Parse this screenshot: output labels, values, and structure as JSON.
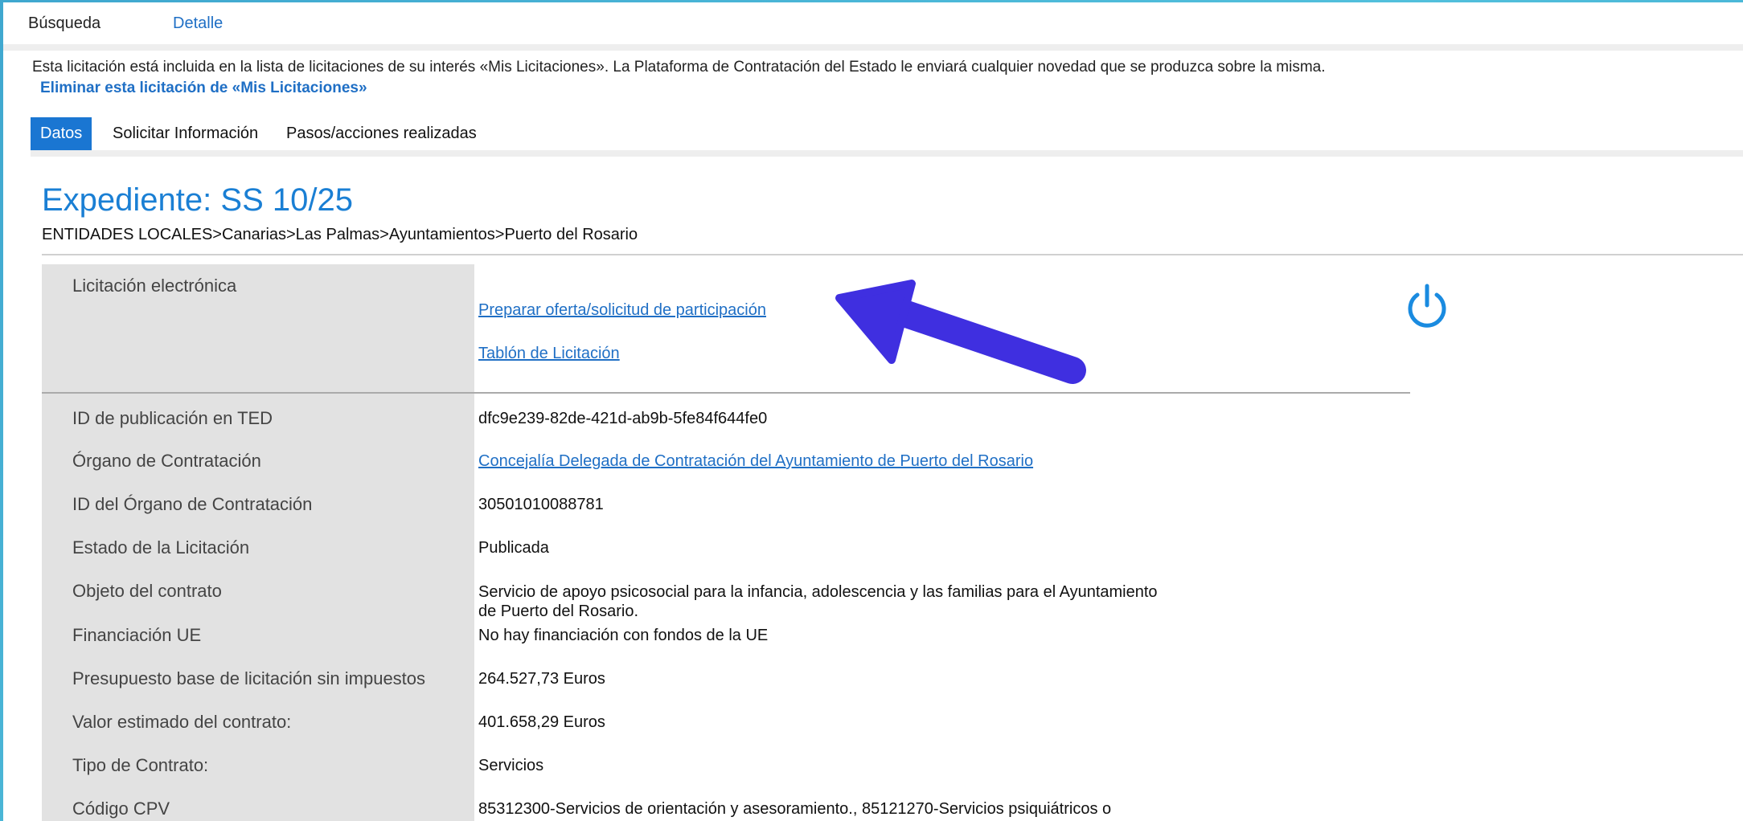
{
  "nav": {
    "search_tab": "Búsqueda",
    "detail_tab": "Detalle"
  },
  "notice": {
    "text": "Esta licitación está incluida en la lista de licitaciones de su interés «Mis Licitaciones». La Plataforma de Contratación del Estado le enviará cualquier novedad que se produzca sobre la misma.",
    "remove_link": "Eliminar esta licitación de «Mis Licitaciones»"
  },
  "subtabs": {
    "datos": "Datos",
    "solicitar": "Solicitar Información",
    "pasos": "Pasos/acciones realizadas"
  },
  "expediente": {
    "title": "Expediente:  SS 10/25",
    "breadcrumb": "ENTIDADES LOCALES>Canarias>Las Palmas>Ayuntamientos>Puerto del Rosario"
  },
  "licitacion_electronica": {
    "label": "Licitación electrónica",
    "preparar_link": "Preparar oferta/solicitud de participación",
    "tablon_link": "Tablón de Licitación",
    "power_icon": "power-icon"
  },
  "arrow_color": "#3f2fe0",
  "rows": [
    {
      "label": "ID de publicación en TED",
      "value": "dfc9e239-82de-421d-ab9b-5fe84f644fe0"
    },
    {
      "label": "Órgano de Contratación",
      "value": "Concejalía Delegada de Contratación del Ayuntamiento de Puerto del Rosario"
    },
    {
      "label": "ID del Órgano de Contratación",
      "value": "30501010088781"
    },
    {
      "label": "Estado de la Licitación",
      "value": "Publicada"
    },
    {
      "label": "Objeto del contrato",
      "value_line1": "Servicio de apoyo psicosocial para la infancia, adolescencia y las familias para el Ayuntamiento",
      "value_line2": "de Puerto del Rosario."
    },
    {
      "label": "Financiación UE",
      "value": "No hay financiación con fondos de la UE"
    },
    {
      "label": "Presupuesto base de licitación sin impuestos",
      "value": "264.527,73  Euros"
    },
    {
      "label": "Valor estimado del contrato:",
      "value": "401.658,29  Euros"
    },
    {
      "label": "Tipo de Contrato:",
      "value": "Servicios"
    },
    {
      "label": "Código CPV",
      "value": "85312300-Servicios de orientación y asesoramiento., 85121270-Servicios psiquiátricos o"
    }
  ]
}
